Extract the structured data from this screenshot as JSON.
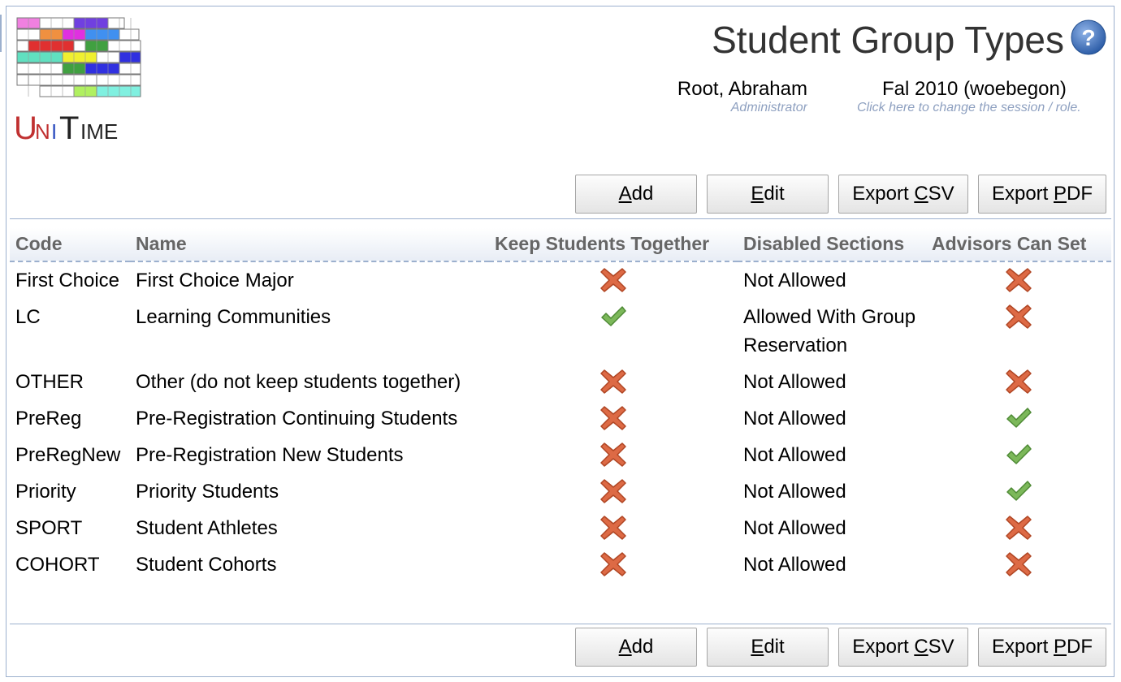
{
  "app": {
    "title": "Student Group Types",
    "logo_text": "UniTime"
  },
  "user": {
    "name": "Root, Abraham",
    "role": "Administrator"
  },
  "session": {
    "name": "Fal 2010 (woebegon)",
    "hint": "Click here to change the session / role."
  },
  "buttons": {
    "add": {
      "accel": "A",
      "rest": "dd"
    },
    "edit": {
      "accel": "E",
      "rest": "dit"
    },
    "export_csv": {
      "pre": "Export ",
      "accel": "C",
      "rest": "SV"
    },
    "export_pdf": {
      "pre": "Export ",
      "accel": "P",
      "rest": "DF"
    }
  },
  "table": {
    "columns": [
      "Code",
      "Name",
      "Keep Students Together",
      "Disabled Sections",
      "Advisors Can Set"
    ],
    "rows": [
      {
        "code": "First Choice",
        "name": "First Choice Major",
        "keep_together": false,
        "disabled_sections": "Not Allowed",
        "advisors_can_set": false
      },
      {
        "code": "LC",
        "name": "Learning Communities",
        "keep_together": true,
        "disabled_sections": "Allowed With Group Reservation",
        "advisors_can_set": false
      },
      {
        "code": "OTHER",
        "name": "Other (do not keep students together)",
        "keep_together": false,
        "disabled_sections": "Not Allowed",
        "advisors_can_set": false
      },
      {
        "code": "PreReg",
        "name": "Pre-Registration Continuing Students",
        "keep_together": false,
        "disabled_sections": "Not Allowed",
        "advisors_can_set": true
      },
      {
        "code": "PreRegNew",
        "name": "Pre-Registration New Students",
        "keep_together": false,
        "disabled_sections": "Not Allowed",
        "advisors_can_set": true
      },
      {
        "code": "Priority",
        "name": "Priority Students",
        "keep_together": false,
        "disabled_sections": "Not Allowed",
        "advisors_can_set": true
      },
      {
        "code": "SPORT",
        "name": "Student Athletes",
        "keep_together": false,
        "disabled_sections": "Not Allowed",
        "advisors_can_set": false
      },
      {
        "code": "COHORT",
        "name": "Student Cohorts",
        "keep_together": false,
        "disabled_sections": "Not Allowed",
        "advisors_can_set": false
      }
    ]
  },
  "icons": {
    "true": "check-icon",
    "false": "cross-icon",
    "help": "help-icon"
  },
  "colors": {
    "border": "#9cb0ce",
    "hint": "#8ea0c0",
    "check": "#6aa84f",
    "cross": "#d9603b"
  }
}
